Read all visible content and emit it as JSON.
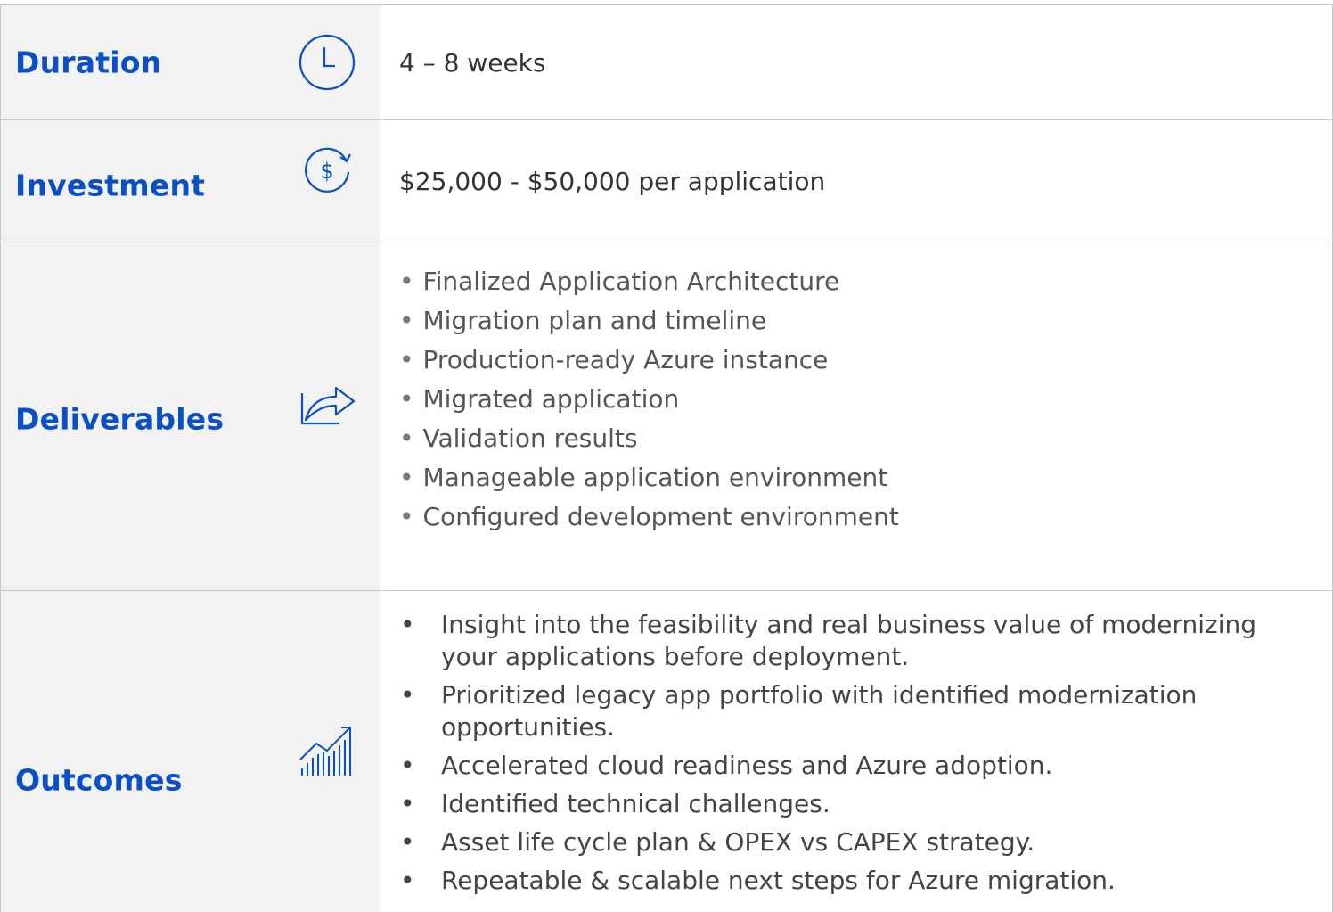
{
  "rows": {
    "duration": {
      "label": "Duration",
      "icon": "clock-icon",
      "value": "4 – 8 weeks"
    },
    "investment": {
      "label": "Investment",
      "icon": "dollar-refresh-icon",
      "value": "$25,000 - $50,000 per application"
    },
    "deliverables": {
      "label": "Deliverables",
      "icon": "share-arrow-icon",
      "items": [
        "Finalized Application Architecture",
        "Migration plan and timeline",
        "Production-ready Azure instance",
        "Migrated application",
        "Validation results",
        "Manageable application environment",
        "Configured development environment"
      ]
    },
    "outcomes": {
      "label": "Outcomes",
      "icon": "growth-chart-icon",
      "items": [
        "Insight into the feasibility and real business value of modernizing your applications before deployment.",
        "Prioritized legacy app portfolio with identified modernization opportunities.",
        "Accelerated cloud readiness and Azure adoption.",
        "Identified technical challenges.",
        "Asset life cycle plan & OPEX vs CAPEX strategy.",
        "Repeatable & scalable next steps for Azure migration."
      ]
    }
  },
  "colors": {
    "accent": "#0a4fc4",
    "label_bg": "#f2f2f2",
    "border": "#c8c8c8"
  }
}
